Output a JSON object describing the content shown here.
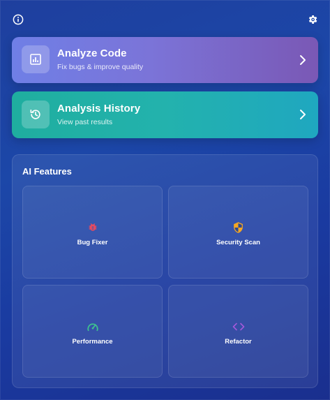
{
  "topbar": {
    "info_icon": "info-icon",
    "settings_icon": "gear-icon"
  },
  "cards": [
    {
      "title": "Analyze Code",
      "subtitle": "Fix bugs & improve quality",
      "icon": "chart-icon"
    },
    {
      "title": "Analysis History",
      "subtitle": "View past results",
      "icon": "history-icon"
    }
  ],
  "features": {
    "title": "AI Features",
    "items": [
      {
        "label": "Bug Fixer",
        "icon": "bug-icon",
        "color": "#e84a5f"
      },
      {
        "label": "Security Scan",
        "icon": "shield-icon",
        "color": "#f5a623"
      },
      {
        "label": "Performance",
        "icon": "speedometer-icon",
        "color": "#3ec28f"
      },
      {
        "label": "Refactor",
        "icon": "code-icon",
        "color": "#a259d9"
      }
    ]
  }
}
